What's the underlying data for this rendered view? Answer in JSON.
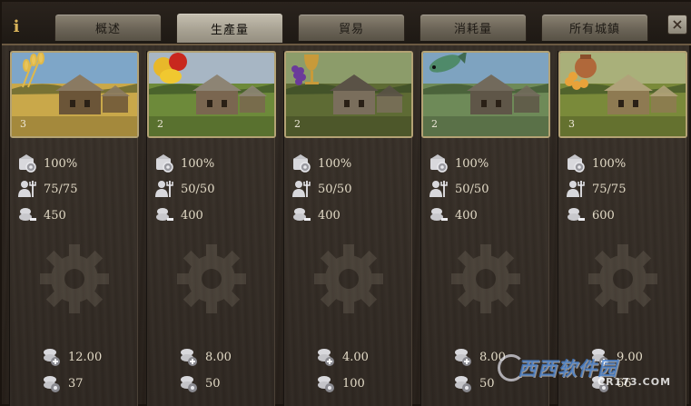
{
  "tabs": [
    {
      "label": "概述",
      "active": false
    },
    {
      "label": "生產量",
      "active": true
    },
    {
      "label": "貿易",
      "active": false
    },
    {
      "label": "消耗量",
      "active": false
    },
    {
      "label": "所有城鎮",
      "active": false
    }
  ],
  "info_icon": "info-icon",
  "close_label": "×",
  "goods": [
    {
      "name_icon": "wheat-icon",
      "buildings": "3",
      "efficiency": "100%",
      "workers": "75/75",
      "production": "450",
      "price": "12.00",
      "stock": "37"
    },
    {
      "name_icon": "fruit-icon",
      "buildings": "2",
      "efficiency": "100%",
      "workers": "50/50",
      "production": "400",
      "price": "8.00",
      "stock": "50"
    },
    {
      "name_icon": "wine-icon",
      "buildings": "2",
      "efficiency": "100%",
      "workers": "50/50",
      "production": "400",
      "price": "4.00",
      "stock": "100"
    },
    {
      "name_icon": "fish-icon",
      "buildings": "2",
      "efficiency": "100%",
      "workers": "50/50",
      "production": "400",
      "price": "8.00",
      "stock": "50"
    },
    {
      "name_icon": "honey-icon",
      "buildings": "3",
      "efficiency": "100%",
      "workers": "75/75",
      "production": "600",
      "price": "9.00",
      "stock": "66"
    }
  ],
  "watermark": {
    "main": "西西软件园",
    "sub": "CR173.COM"
  }
}
